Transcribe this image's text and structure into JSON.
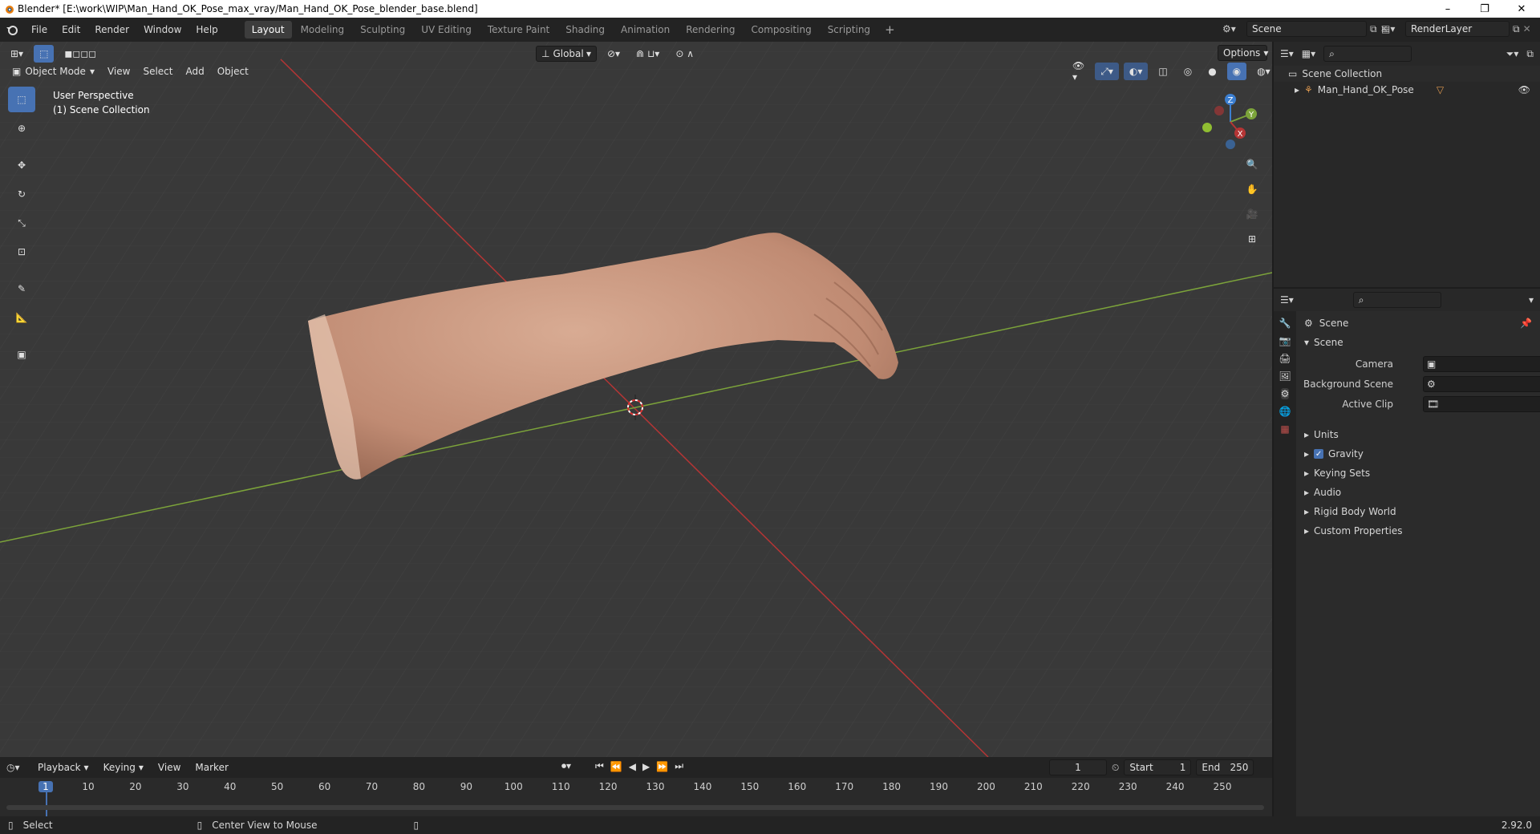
{
  "window": {
    "title": "Blender* [E:\\work\\WIP\\Man_Hand_OK_Pose_max_vray/Man_Hand_OK_Pose_blender_base.blend]",
    "minimize": "–",
    "restore": "❐",
    "close": "✕"
  },
  "menu": {
    "file": "File",
    "edit": "Edit",
    "render": "Render",
    "window": "Window",
    "help": "Help"
  },
  "workspaces": [
    {
      "label": "Layout",
      "active": true
    },
    {
      "label": "Modeling"
    },
    {
      "label": "Sculpting"
    },
    {
      "label": "UV Editing"
    },
    {
      "label": "Texture Paint"
    },
    {
      "label": "Shading"
    },
    {
      "label": "Animation"
    },
    {
      "label": "Rendering"
    },
    {
      "label": "Compositing"
    },
    {
      "label": "Scripting"
    }
  ],
  "scene": {
    "name": "Scene"
  },
  "renderlayer": {
    "name": "RenderLayer"
  },
  "viewport": {
    "transform_orientation": "Global",
    "options": "Options",
    "mode": "Object Mode",
    "view": "View",
    "select": "Select",
    "add": "Add",
    "object": "Object",
    "overlay_line1": "User Perspective",
    "overlay_line2": "(1) Scene Collection",
    "gizmo": {
      "x": "X",
      "y": "Y",
      "z": "Z"
    }
  },
  "outliner": {
    "root": "Scene Collection",
    "items": [
      {
        "name": "Man_Hand_OK_Pose"
      }
    ]
  },
  "properties": {
    "context": "Scene",
    "section": "Scene",
    "camera_label": "Camera",
    "background_label": "Background Scene",
    "clip_label": "Active Clip",
    "panels": [
      "Units",
      "Gravity",
      "Keying Sets",
      "Audio",
      "Rigid Body World",
      "Custom Properties"
    ],
    "gravity_checked": true
  },
  "timeline": {
    "playback": "Playback",
    "keying": "Keying",
    "view": "View",
    "marker": "Marker",
    "current_frame": "1",
    "start_label": "Start",
    "start": "1",
    "end_label": "End",
    "end": "250",
    "ticks": [
      "1",
      "10",
      "20",
      "30",
      "40",
      "50",
      "60",
      "70",
      "80",
      "90",
      "100",
      "110",
      "120",
      "130",
      "140",
      "150",
      "160",
      "170",
      "180",
      "190",
      "200",
      "210",
      "220",
      "230",
      "240",
      "250"
    ]
  },
  "status": {
    "select": "Select",
    "center": "Center View to Mouse",
    "version": "2.92.0"
  },
  "colors": {
    "accent": "#4772b3",
    "x_axis": "#b53535",
    "y_axis": "#7ca33a",
    "z_axis": "#3c7fd1",
    "skin": "#c89a82",
    "frame_marker": "#4772b3"
  }
}
